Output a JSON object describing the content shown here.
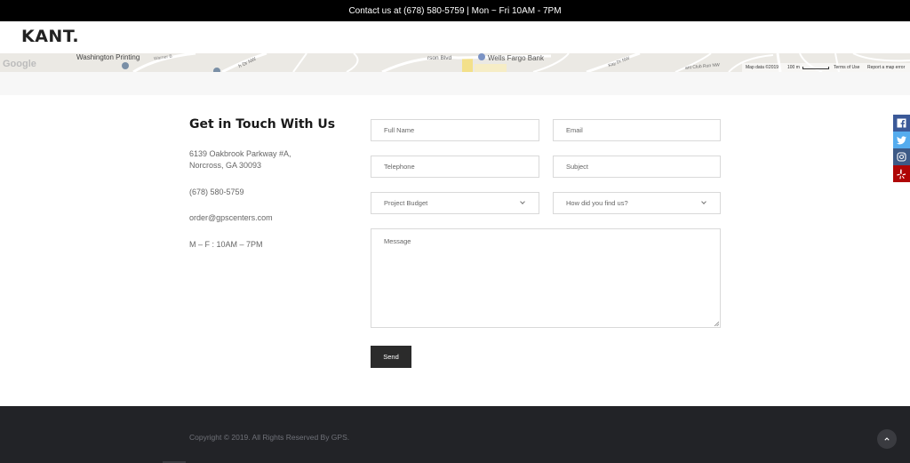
{
  "topbar": {
    "text": "Contact us at (678) 580-5759 | Mon ~ Fri 10AM - 7PM"
  },
  "header": {
    "logo": "KANT."
  },
  "map": {
    "google_label": "Google",
    "labels": {
      "washington_printing": "Washington Printing",
      "warner_blvd": "Warner B",
      "dr_nw": "h Dr NW",
      "jimmy_blvd": "rson Blvd",
      "wells_fargo": "Wells Fargo Bank",
      "kay_dr": "Kay Dr NW",
      "club_run": "ant Club Run NW",
      "map_data": "Map data ©2019",
      "scale": "100 m",
      "terms": "Terms of Use",
      "report": "Report a map error"
    }
  },
  "contact": {
    "title": "Get in Touch With Us",
    "address_line1": "6139 Oakbrook Parkway #A,",
    "address_line2": "Norcross, GA 30093",
    "phone": "(678) 580-5759",
    "email": "order@gpscenters.com",
    "hours": "M – F : 10AM – 7PM"
  },
  "form": {
    "full_name_placeholder": "Full Name",
    "email_placeholder": "Email",
    "telephone_placeholder": "Telephone",
    "subject_placeholder": "Subject",
    "budget_selected": "Project Budget",
    "source_selected": "How did you find us?",
    "message_placeholder": "Message",
    "send_label": "Send"
  },
  "social": {
    "icons": [
      "facebook-icon",
      "twitter-icon",
      "instagram-icon",
      "yelp-icon"
    ],
    "colors": {
      "facebook": "#3b5998",
      "twitter": "#55acee",
      "instagram": "#3d5a86",
      "yelp": "#af0606"
    }
  },
  "footer": {
    "copyright": "Copyright © 2019. All Rights Reserved By GPS."
  },
  "colors": {
    "topbar": "#000000",
    "footer": "#222327",
    "button": "#2b2b2b"
  }
}
